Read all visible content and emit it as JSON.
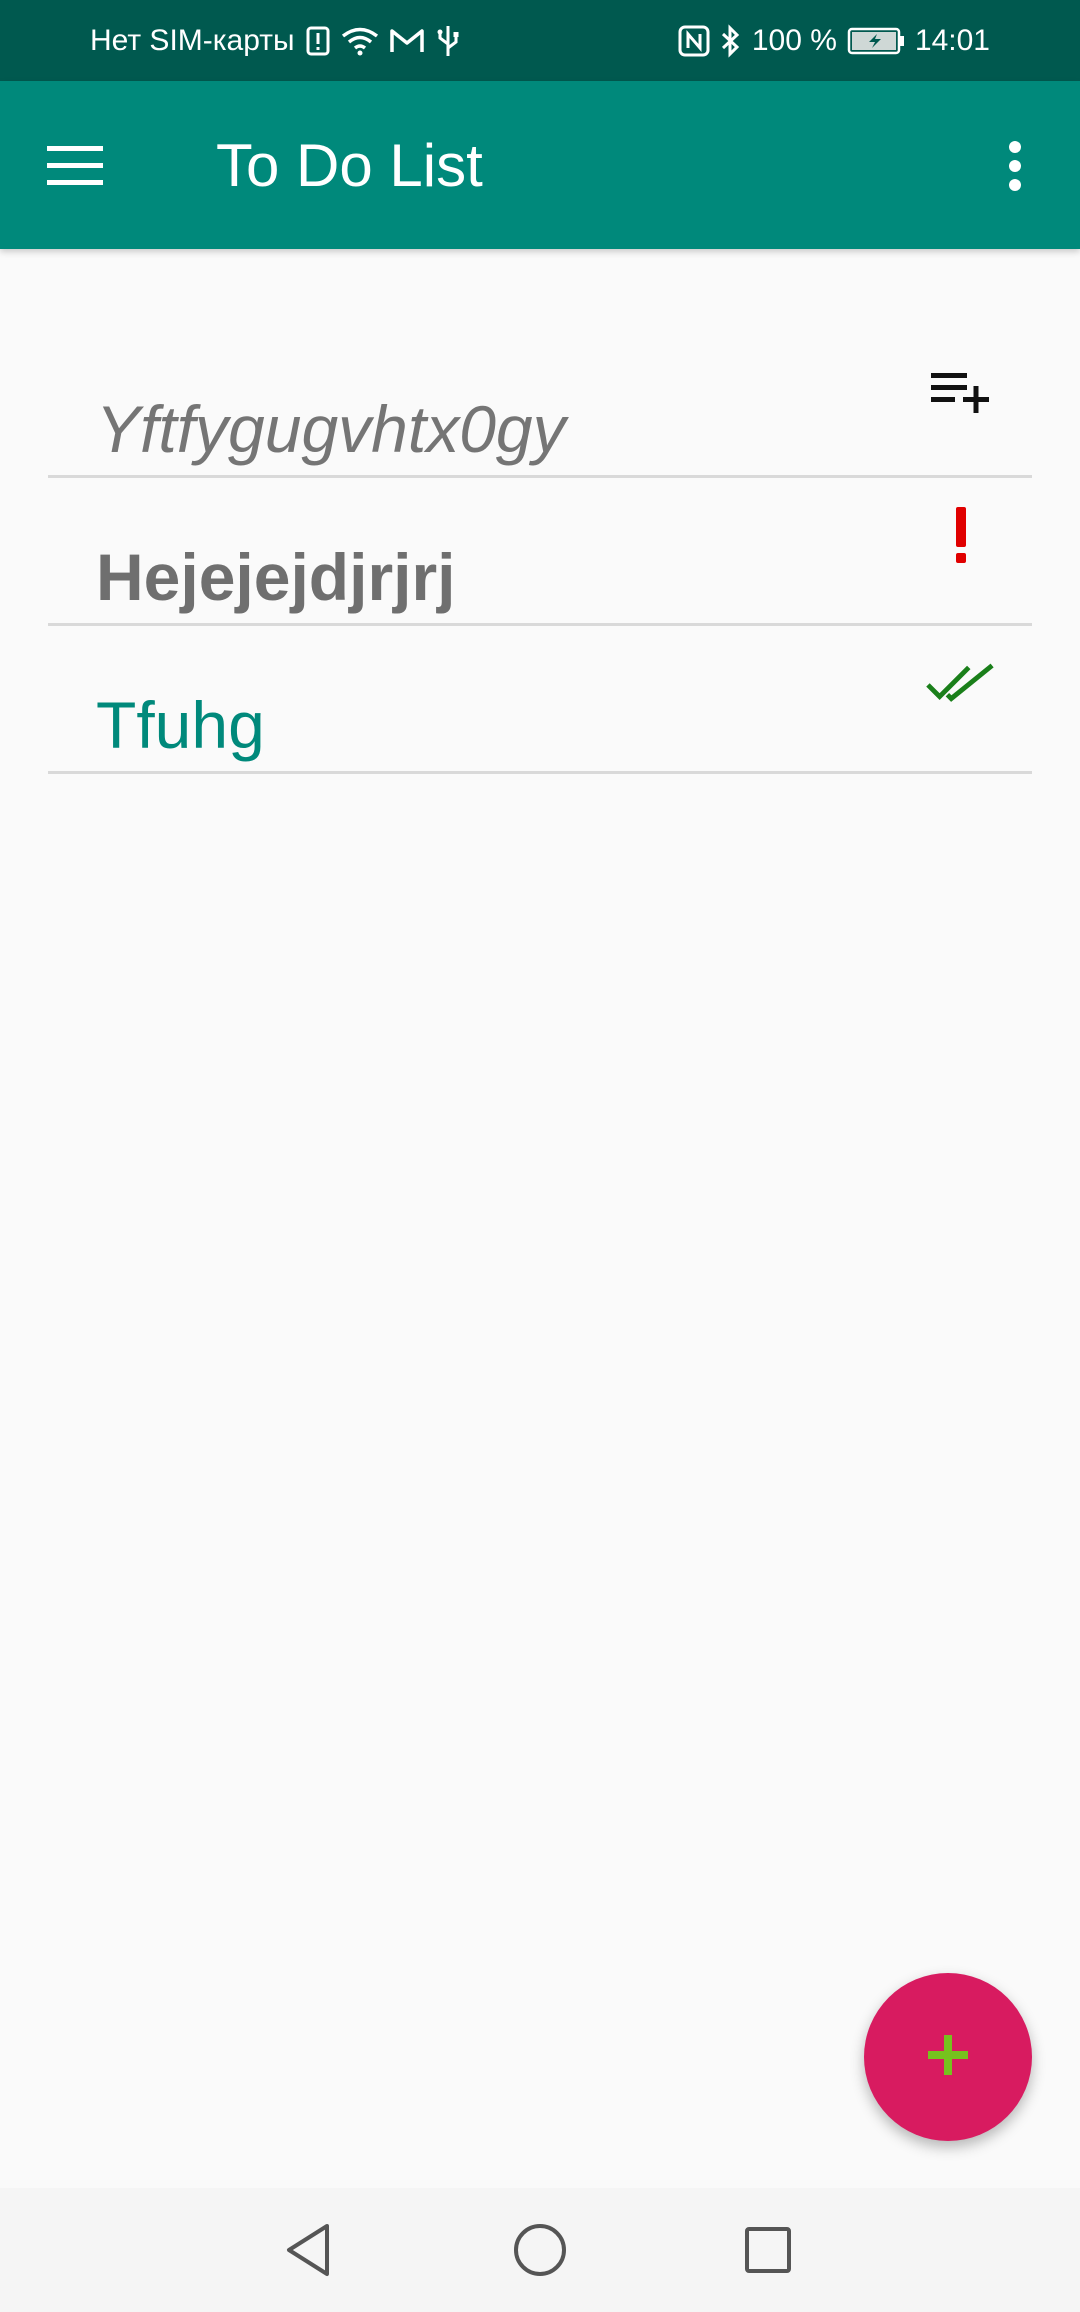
{
  "status_bar": {
    "carrier": "Нет SIM-карты",
    "battery": "100 %",
    "time": "14:01",
    "icons": [
      "alert-icon",
      "wifi-icon",
      "gmail-icon",
      "usb-icon",
      "nfc-icon",
      "bluetooth-icon",
      "battery-icon"
    ]
  },
  "app_bar": {
    "title": "To Do List",
    "menu_icon": "hamburger-menu-icon",
    "overflow_icon": "more-vertical-icon"
  },
  "new_item": {
    "value": "Yftfygugvhtx0gy",
    "action_icon": "playlist-add-icon"
  },
  "items": [
    {
      "text": "Hejejejdjrjrj",
      "status": "important",
      "icon": "exclamation-icon",
      "color": "#e00000"
    },
    {
      "text": "Tfuhg",
      "status": "done",
      "icon": "double-check-icon",
      "color": "#1a7f1a"
    }
  ],
  "fab": {
    "icon": "plus-icon",
    "background": "#d81b60",
    "icon_color": "#76c21e"
  },
  "colors": {
    "status_bar": "#00594f",
    "app_bar": "#00897b",
    "accent_text": "#00897b",
    "important": "#e00000"
  },
  "nav_bar": {
    "icons": [
      "back-icon",
      "home-icon",
      "recents-icon"
    ]
  }
}
